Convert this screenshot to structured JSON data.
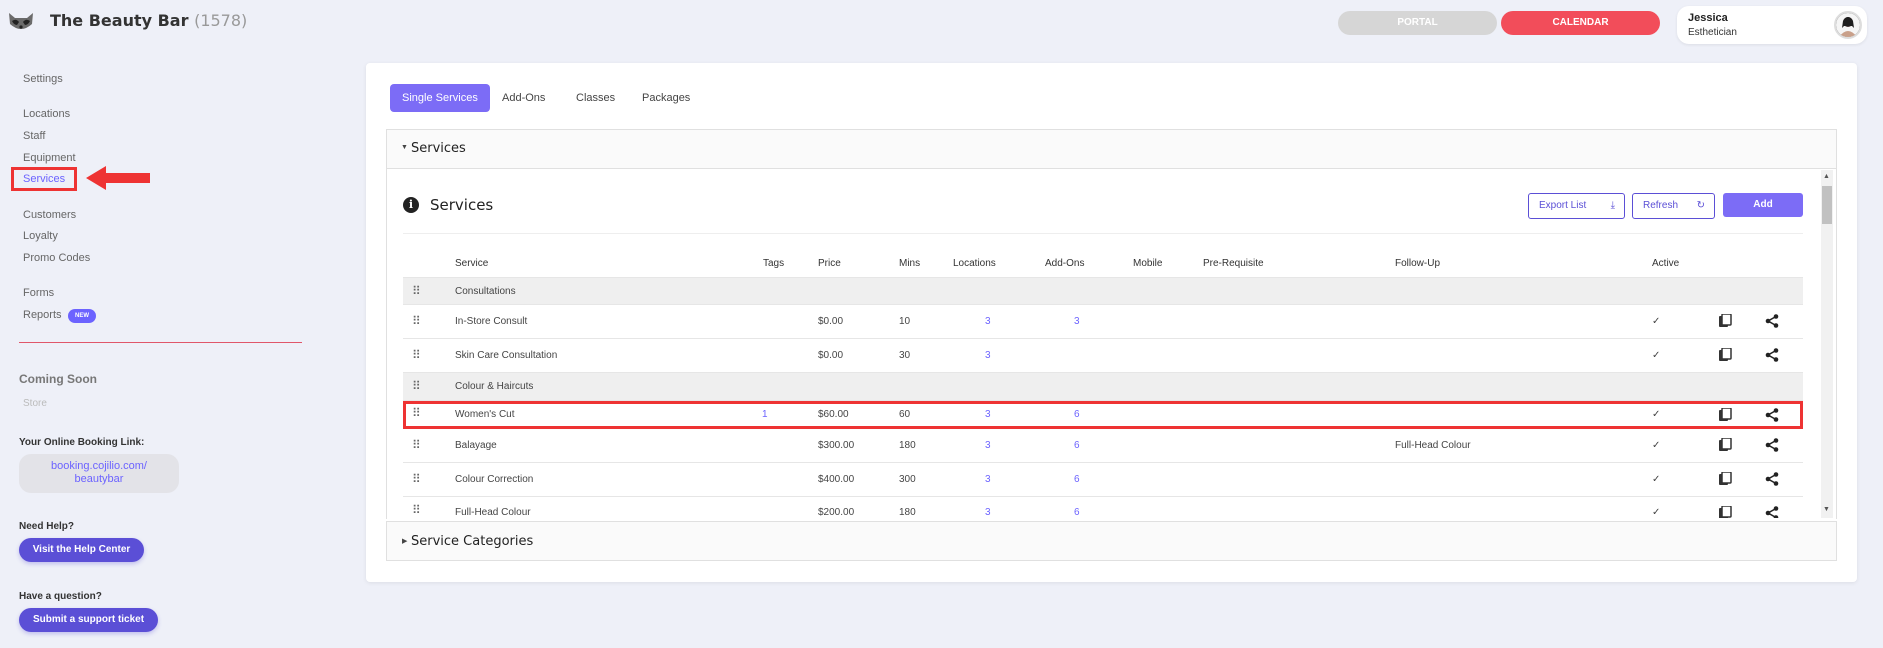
{
  "header": {
    "brand": "The Beauty Bar",
    "brand_count": "(1578)",
    "portal_label": "PORTAL",
    "calendar_label": "CALENDAR",
    "user_name": "Jessica",
    "user_role": "Esthetician"
  },
  "sidebar": {
    "settings": "Settings",
    "locations": "Locations",
    "staff": "Staff",
    "equipment": "Equipment",
    "services": "Services",
    "customers": "Customers",
    "loyalty": "Loyalty",
    "promo_codes": "Promo Codes",
    "forms": "Forms",
    "reports": "Reports",
    "reports_badge": "NEW",
    "coming_soon": "Coming Soon",
    "store": "Store",
    "booking_label": "Your Online Booking Link:",
    "booking_line1": "booking.cojilio.com/",
    "booking_line2": "beautybar",
    "help_label": "Need Help?",
    "help_button": "Visit the Help Center",
    "question_label": "Have a question?",
    "ticket_button": "Submit a support ticket"
  },
  "tabs": [
    "Single Services",
    "Add-Ons",
    "Classes",
    "Packages"
  ],
  "panel": {
    "services_header": "Services",
    "services_title": "Services",
    "export_label": "Export List",
    "refresh_label": "Refresh",
    "add_label": "Add",
    "categories_header": "Service Categories"
  },
  "table": {
    "columns": [
      "Service",
      "Tags",
      "Price",
      "Mins",
      "Locations",
      "Add-Ons",
      "Mobile",
      "Pre-Requisite",
      "Follow-Up",
      "Active"
    ],
    "rows": [
      {
        "category": "Consultations"
      },
      {
        "service": "In-Store Consult",
        "tags": "",
        "price": "$0.00",
        "mins": "10",
        "locations": "3",
        "addons": "3",
        "followup": "",
        "active": "✓"
      },
      {
        "service": "Skin Care Consultation",
        "tags": "",
        "price": "$0.00",
        "mins": "30",
        "locations": "3",
        "addons": "",
        "followup": "",
        "active": "✓"
      },
      {
        "category": "Colour & Haircuts"
      },
      {
        "service": "Women's Cut",
        "tags": "1",
        "price": "$60.00",
        "mins": "60",
        "locations": "3",
        "addons": "6",
        "followup": "",
        "active": "✓"
      },
      {
        "service": "Balayage",
        "tags": "",
        "price": "$300.00",
        "mins": "180",
        "locations": "3",
        "addons": "6",
        "followup": "Full-Head Colour",
        "active": "✓"
      },
      {
        "service": "Colour Correction",
        "tags": "",
        "price": "$400.00",
        "mins": "300",
        "locations": "3",
        "addons": "6",
        "followup": "",
        "active": "✓"
      },
      {
        "service": "Full-Head Colour",
        "tags": "",
        "price": "$200.00",
        "mins": "180",
        "locations": "3",
        "addons": "6",
        "followup": "",
        "active": "✓"
      }
    ]
  },
  "icons": {
    "copy": "copy-icon",
    "share": "share-icon",
    "drag": "drag-handle-icon",
    "info": "info-icon"
  },
  "colors": {
    "accent": "#6c63ff",
    "calendar": "#f24d5a",
    "annotation": "#e33333"
  }
}
